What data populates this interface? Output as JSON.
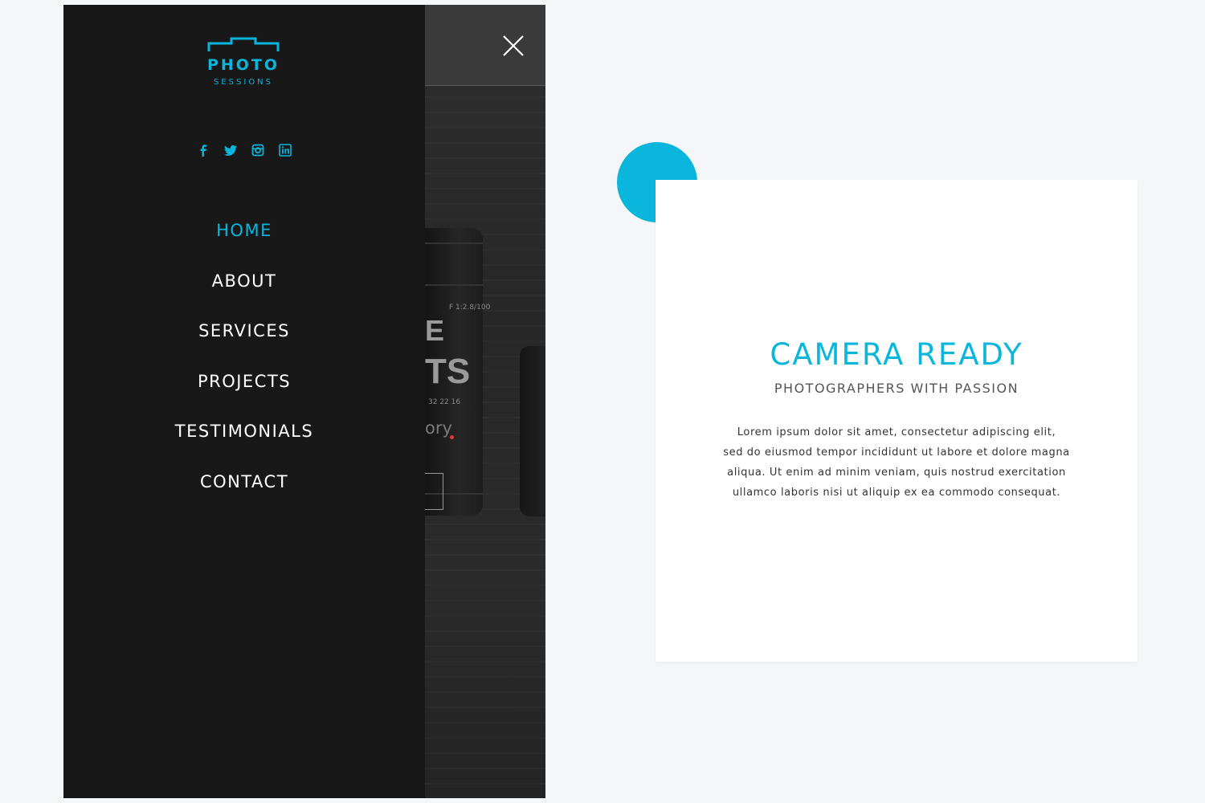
{
  "brand": {
    "logo_word": "PHOTO",
    "logo_sub": "SESSIONS",
    "accent_color": "#0ab6dc"
  },
  "social": [
    {
      "icon": "facebook-icon"
    },
    {
      "icon": "twitter-icon"
    },
    {
      "icon": "instagram-icon"
    },
    {
      "icon": "linkedin-icon"
    }
  ],
  "menu": {
    "items": [
      {
        "label": "HOME",
        "active": true
      },
      {
        "label": "ABOUT",
        "active": false
      },
      {
        "label": "SERVICES",
        "active": false
      },
      {
        "label": "PROJECTS",
        "active": false
      },
      {
        "label": "TESTIMONIALS",
        "active": false
      },
      {
        "label": "CONTACT",
        "active": false
      }
    ],
    "close_icon": "close-icon"
  },
  "hero_fragments": {
    "line1": "E",
    "line2": "TS",
    "line3": "ory"
  },
  "lens_markings": {
    "top": "F 1:2.8/100",
    "mid": "32  22  16"
  },
  "card": {
    "title": "CAMERA READY",
    "subtitle": "PHOTOGRAPHERS WITH PASSION",
    "body_lines": [
      "Lorem ipsum dolor sit amet, consectetur adipiscing elit,",
      "sed do eiusmod tempor incididunt ut labore et dolore magna",
      "aliqua. Ut enim ad minim veniam, quis nostrud exercitation",
      "ullamco laboris nisi ut aliquip ex ea commodo consequat."
    ]
  }
}
